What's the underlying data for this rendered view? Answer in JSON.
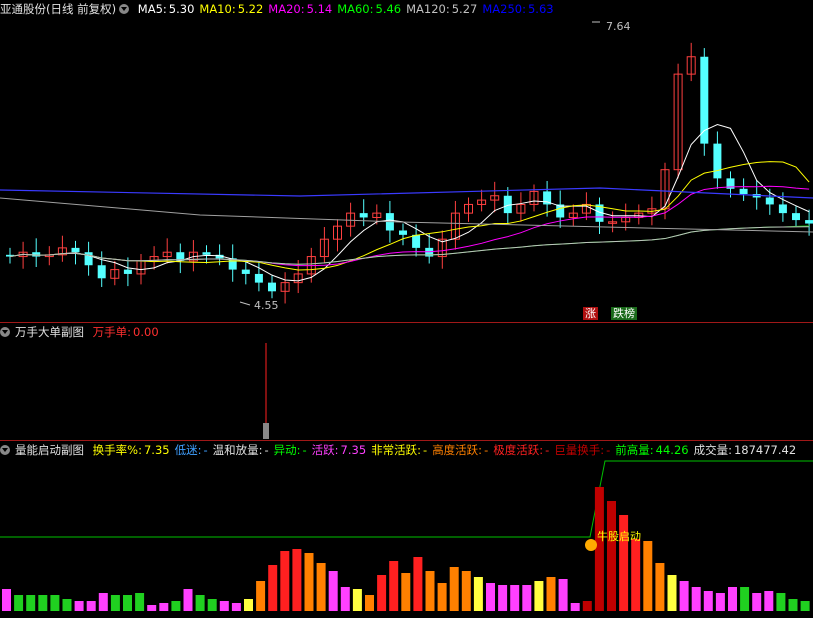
{
  "main": {
    "title": "亚通股份(日线 前复权)",
    "ma": [
      {
        "label": "MA5:",
        "value": "5.30",
        "color": "#ffffff"
      },
      {
        "label": "MA10:",
        "value": "5.22",
        "color": "#ffff00"
      },
      {
        "label": "MA20:",
        "value": "5.14",
        "color": "#ff00ff"
      },
      {
        "label": "MA60:",
        "value": "5.46",
        "color": "#00ff00"
      },
      {
        "label": "MA120:",
        "value": "5.27",
        "color": "#c0c0c0"
      },
      {
        "label": "MA250:",
        "value": "5.63",
        "color": "#0000ff"
      }
    ],
    "high_label": "7.64",
    "low_label": "4.55",
    "tag_up": "涨",
    "tag_rank": "跌榜"
  },
  "sub1": {
    "title": "万手大单副图",
    "indicator_label": "万手单:",
    "indicator_value": "0.00"
  },
  "sub2": {
    "title": "量能启动副图",
    "items": [
      {
        "label": "换手率%:",
        "value": "7.35",
        "color": "#ffff00"
      },
      {
        "label": "低迷:",
        "value": "-",
        "color": "#40a0ff"
      },
      {
        "label": "温和放量:",
        "value": "-",
        "color": "#e0e0e0"
      },
      {
        "label": "异动:",
        "value": "-",
        "color": "#00ff00"
      },
      {
        "label": "活跃:",
        "value": "7.35",
        "color": "#ff40ff"
      },
      {
        "label": "非常活跃:",
        "value": "-",
        "color": "#ffff00"
      },
      {
        "label": "高度活跃:",
        "value": "-",
        "color": "#ff8000"
      },
      {
        "label": "极度活跃:",
        "value": "-",
        "color": "#ff2020"
      },
      {
        "label": "巨量换手:",
        "value": "-",
        "color": "#c00000"
      },
      {
        "label": "前高量:",
        "value": "44.26",
        "color": "#00ff00"
      },
      {
        "label": "成交量:",
        "value": "187477.42",
        "color": "#e0e0e0"
      }
    ],
    "signal_label": "牛股启动"
  },
  "colors": {
    "up": "#ff4040",
    "down": "#54ffff",
    "frame": "#a01818"
  }
}
